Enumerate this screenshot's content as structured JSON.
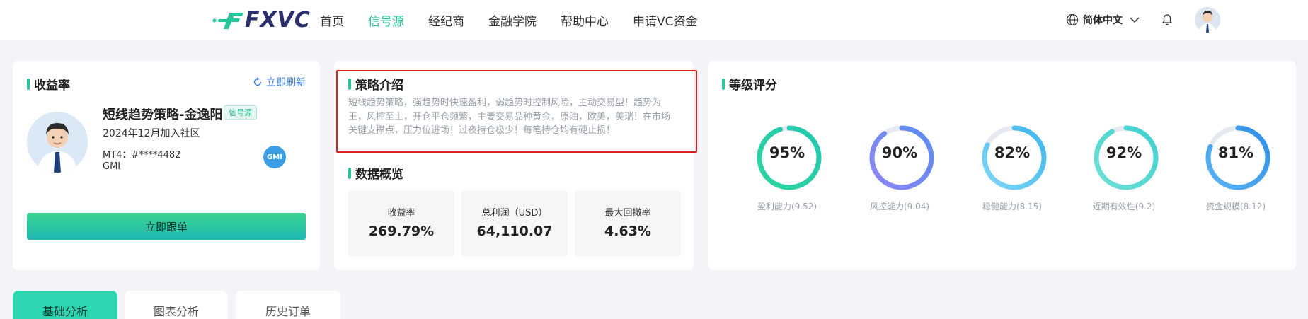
{
  "header": {
    "logo_text": "FXVC",
    "nav": [
      {
        "label": "首页",
        "active": false
      },
      {
        "label": "信号源",
        "active": true
      },
      {
        "label": "经纪商",
        "active": false
      },
      {
        "label": "金融学院",
        "active": false
      },
      {
        "label": "帮助中心",
        "active": false
      },
      {
        "label": "申请VC资金",
        "active": false
      }
    ],
    "language": "简体中文"
  },
  "returns_card": {
    "title": "收益率",
    "refresh_label": "立即刷新",
    "strategy_name": "短线趋势策略-金逸阳",
    "badge": "信号源",
    "join_date": "2024年12月加入社区",
    "mt4": "MT4：#****4482",
    "broker": "GMI",
    "broker_logo_text": "GMI",
    "follow_button": "立即跟单"
  },
  "strategy_card": {
    "title": "策略介绍",
    "intro": "短线趋势策略，强趋势时快速盈利，弱趋势时控制风险，主动交易型！趋势为王，风控至上，开仓平仓频繁，主要交易品种黄金，原油，欧美，美瑞！在市场关键支撑点，压力位进场！过夜持仓极少！每笔持仓均有硬止损！",
    "overview_title": "数据概览",
    "stats": [
      {
        "label": "收益率",
        "value": "269.79%"
      },
      {
        "label": "总利润（USD）",
        "value": "64,110.07"
      },
      {
        "label": "最大回撤率",
        "value": "4.63%"
      }
    ]
  },
  "rating_card": {
    "title": "等级评分",
    "gauges": [
      {
        "value": "95%",
        "percent": 95,
        "label": "盈利能力(9.52)",
        "color_start": "#2fd4a0",
        "color_end": "#22c7b0"
      },
      {
        "value": "90%",
        "percent": 90,
        "label": "风控能力(9.04)",
        "color_start": "#8f86f5",
        "color_end": "#5a8df0"
      },
      {
        "value": "82%",
        "percent": 82,
        "label": "稳健能力(8.15)",
        "color_start": "#7fd6f5",
        "color_end": "#3fb6ec"
      },
      {
        "value": "92%",
        "percent": 92,
        "label": "近期有效性(9.2)",
        "color_start": "#6fe0d6",
        "color_end": "#3fcfd0"
      },
      {
        "value": "81%",
        "percent": 81,
        "label": "资金规模(8.12)",
        "color_start": "#5ab3f3",
        "color_end": "#2f8fe6"
      }
    ]
  },
  "tabs": [
    {
      "label": "基础分析",
      "active": true
    },
    {
      "label": "图表分析",
      "active": false
    },
    {
      "label": "历史订单",
      "active": false
    }
  ],
  "colors": {
    "accent": "#27c59a",
    "link": "#3a7ee8",
    "highlight_border": "#e02020"
  }
}
